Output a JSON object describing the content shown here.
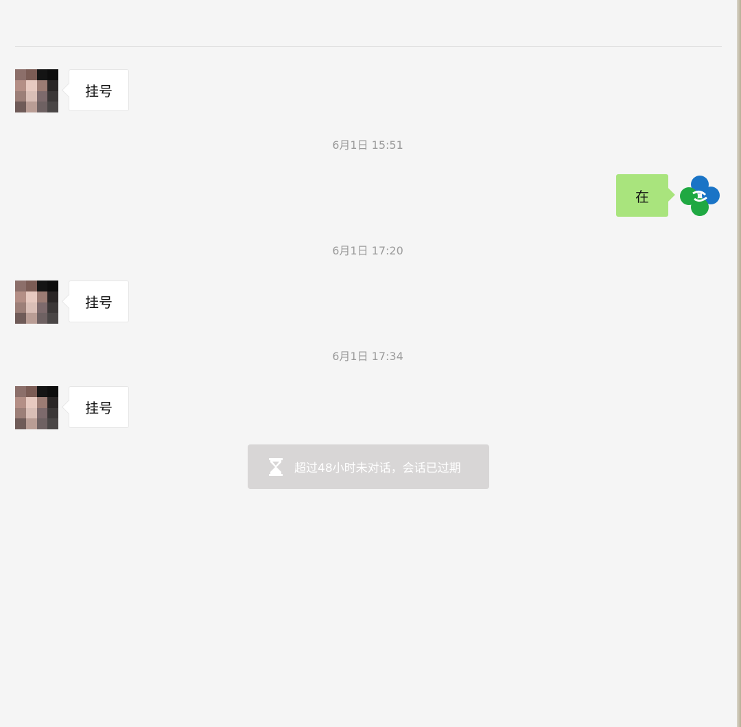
{
  "messages": [
    {
      "side": "left",
      "text": "挂号"
    },
    {
      "type": "timestamp",
      "text": "6月1日 15:51"
    },
    {
      "side": "right",
      "text": "在"
    },
    {
      "type": "timestamp",
      "text": "6月1日 17:20"
    },
    {
      "side": "left",
      "text": "挂号"
    },
    {
      "type": "timestamp",
      "text": "6月1日 17:34"
    },
    {
      "side": "left",
      "text": "挂号"
    }
  ],
  "notice": {
    "icon": "hourglass-icon",
    "text": "超过48小时未对话，会话已过期"
  },
  "colors": {
    "background": "#f5f5f5",
    "sent_bubble": "#a9e47d",
    "received_bubble": "#ffffff",
    "timestamp_text": "#9a9a9a",
    "notice_background": "#d8d6d6",
    "logo_blue": "#1a74c6",
    "logo_green": "#1fa842"
  }
}
